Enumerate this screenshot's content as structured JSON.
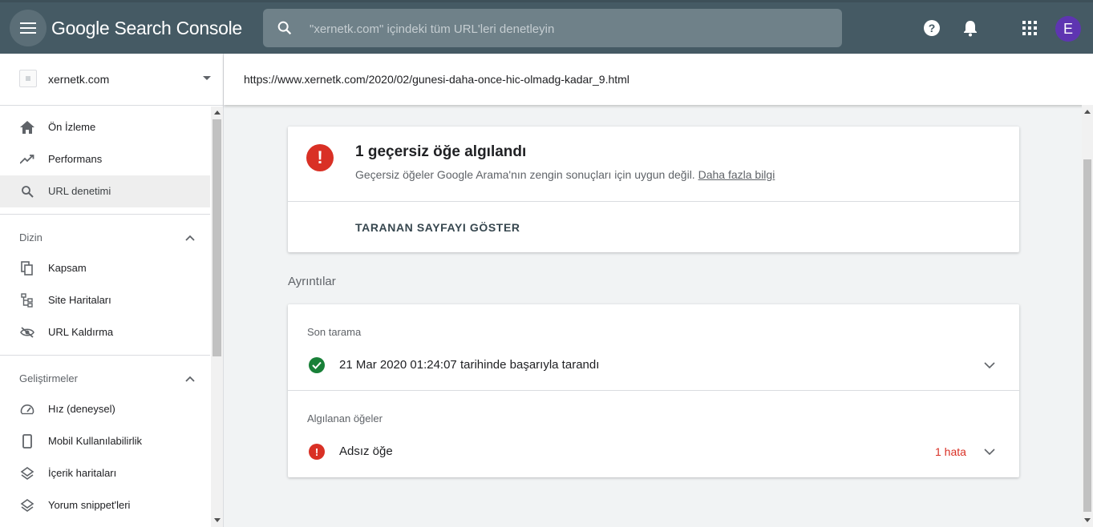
{
  "header": {
    "app_title": "Google Search Console",
    "search_placeholder": "\"xernetk.com\" içindeki tüm URL'leri denetleyin",
    "avatar_initial": "E",
    "icons": [
      "menu-icon",
      "search-icon",
      "help-icon",
      "notifications-icon",
      "apps-icon"
    ],
    "color": "#455a64"
  },
  "sidebar": {
    "property": "xernetk.com",
    "items": [
      {
        "label": "Ön İzleme",
        "icon": "home-icon"
      },
      {
        "label": "Performans",
        "icon": "trending-up-icon"
      },
      {
        "label": "URL denetimi",
        "icon": "search-icon",
        "active": true
      }
    ],
    "sections": [
      {
        "title": "Dizin",
        "items": [
          {
            "label": "Kapsam",
            "icon": "copy-icon"
          },
          {
            "label": "Site Haritaları",
            "icon": "sitemap-icon"
          },
          {
            "label": "URL Kaldırma",
            "icon": "visibility-off-icon"
          }
        ]
      },
      {
        "title": "Geliştirmeler",
        "items": [
          {
            "label": "Hız (deneysel)",
            "icon": "speed-icon"
          },
          {
            "label": "Mobil Kullanılabilirlik",
            "icon": "phone-icon"
          },
          {
            "label": "İçerik haritaları",
            "icon": "layers-icon"
          },
          {
            "label": "Yorum snippet'leri",
            "icon": "layers-icon"
          }
        ]
      }
    ]
  },
  "main": {
    "url": "https://www.xernetk.com/2020/02/gunesi-daha-once-hic-olmadg-kadar_9.html",
    "status_card": {
      "title": "1 geçersiz öğe algılandı",
      "description": "Geçersiz öğeler Google Arama'nın zengin sonuçları için uygun değil.",
      "link_text": "Daha fazla bilgi",
      "action_label": "TARANAN SAYFAYI GÖSTER",
      "error_color": "#d93025"
    },
    "details_heading": "Ayrıntılar",
    "details": {
      "last_crawl_label": "Son tarama",
      "last_crawl_text": "21 Mar 2020 01:24:07 tarihinde başarıyla tarandı",
      "detected_items_label": "Algılanan öğeler",
      "detected_item_name": "Adsız öğe",
      "detected_item_errors": "1 hata",
      "success_color": "#188038"
    }
  }
}
